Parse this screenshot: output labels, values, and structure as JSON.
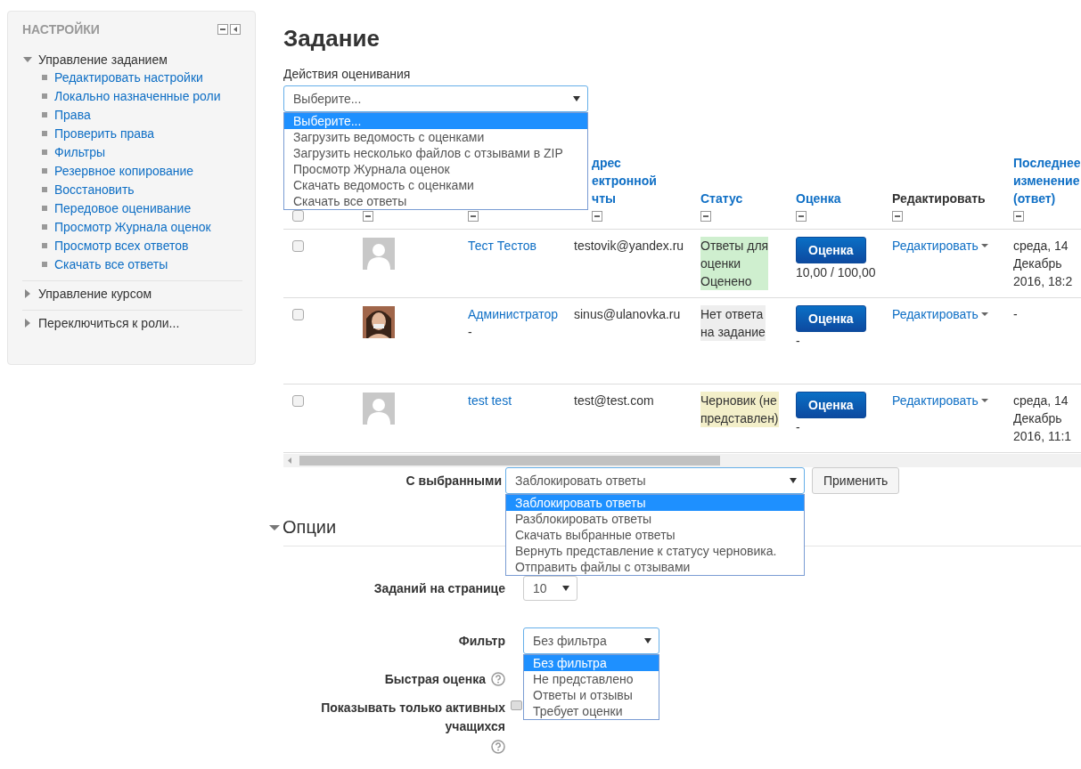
{
  "sidebar": {
    "title": "НАСТРОЙКИ",
    "blocks": [
      {
        "label": "Управление заданием",
        "expanded": true,
        "children": [
          "Редактировать настройки",
          "Локально назначенные роли",
          "Права",
          "Проверить права",
          "Фильтры",
          "Резервное копирование",
          "Восстановить",
          "Передовое оценивание",
          "Просмотр Журнала оценок",
          "Просмотр всех ответов",
          "Скачать все ответы"
        ]
      },
      {
        "label": "Управление курсом",
        "expanded": false
      },
      {
        "label": "Переключиться к роли...",
        "expanded": false
      }
    ]
  },
  "page_title": "Задание",
  "grading_actions": {
    "label": "Действия оценивания",
    "value": "Выберите...",
    "expanded": true,
    "options": [
      {
        "label": "Выберите...",
        "selected": true
      },
      {
        "label": "Загрузить ведомость с оценками",
        "selected": false
      },
      {
        "label": "Загрузить несколько файлов с отзывами в ZIP",
        "selected": false
      },
      {
        "label": "Просмотр Журнала оценок",
        "selected": false
      },
      {
        "label": "Скачать ведомость с оценками",
        "selected": false
      },
      {
        "label": "Скачать все ответы",
        "selected": false
      }
    ]
  },
  "table": {
    "columns": [
      {
        "kind": "checkbox",
        "checked": false
      },
      {
        "kind": "blank"
      },
      {
        "kind": "blank"
      },
      {
        "kind": "link",
        "lines": [
          "дрес",
          "ектронной",
          "чты"
        ]
      },
      {
        "kind": "link",
        "lines": [
          "Статус"
        ]
      },
      {
        "kind": "link",
        "lines": [
          "Оценка"
        ]
      },
      {
        "kind": "plain",
        "lines": [
          "Редактировать"
        ]
      },
      {
        "kind": "link",
        "lines": [
          "Последнее",
          "изменение",
          "(ответ)"
        ]
      }
    ],
    "rows": [
      {
        "checked": false,
        "photo": false,
        "name": "Тест Тестов",
        "email": "testovik@yandex.ru",
        "status": {
          "kind": "graded",
          "lines": [
            "Ответы для",
            "оценки",
            "Оценено"
          ]
        },
        "grade_button": "Оценка",
        "grade": "10,00 / 100,00",
        "edit": "Редактировать",
        "modified": [
          "среда, 14",
          "Декабрь",
          "2016, 18:2"
        ]
      },
      {
        "checked": false,
        "photo": true,
        "name": "Администратор",
        "name_note": "-",
        "email": "sinus@ulanovka.ru",
        "status": {
          "kind": "none",
          "lines": [
            "Нет ответа",
            "на задание"
          ]
        },
        "grade_button": "Оценка",
        "grade": "-",
        "edit": "Редактировать",
        "modified": [
          "-"
        ]
      },
      {
        "checked": false,
        "photo": false,
        "name": "test test",
        "email": "test@test.com",
        "status": {
          "kind": "draft",
          "lines": [
            "Черновик (не",
            "представлен)"
          ]
        },
        "grade_button": "Оценка",
        "grade": "-",
        "edit": "Редактировать",
        "modified": [
          "среда, 14",
          "Декабрь",
          "2016, 11:1"
        ]
      }
    ]
  },
  "bulk": {
    "label": "С выбранными",
    "value": "Заблокировать ответы",
    "expanded": true,
    "apply": "Применить",
    "options": [
      {
        "label": "Заблокировать ответы",
        "selected": true
      },
      {
        "label": "Разблокировать ответы",
        "selected": false
      },
      {
        "label": "Скачать выбранные ответы",
        "selected": false
      },
      {
        "label": "Вернуть представление к статусу черновика.",
        "selected": false
      },
      {
        "label": "Отправить файлы с отзывами",
        "selected": false
      }
    ]
  },
  "options": {
    "title": "Опции",
    "expanded": true,
    "per_page": {
      "label": "Заданий на странице",
      "value": "10"
    },
    "filter": {
      "label": "Фильтр",
      "value": "Без фильтра",
      "expanded": true,
      "options": [
        {
          "label": "Без фильтра",
          "selected": true
        },
        {
          "label": "Не представлено",
          "selected": false
        },
        {
          "label": "Ответы и отзывы",
          "selected": false
        },
        {
          "label": "Требует оценки",
          "selected": false
        }
      ]
    },
    "quick_grading": {
      "label": "Быстрая оценка"
    },
    "active_only": {
      "label": "Показывать только активных учащихся",
      "checked": false
    }
  }
}
